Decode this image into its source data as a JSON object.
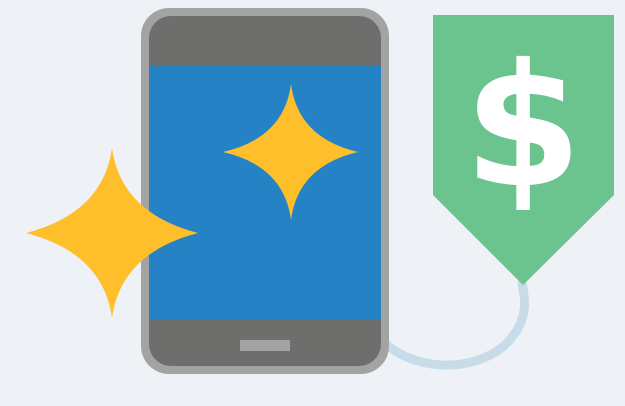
{
  "illustration": {
    "price_tag": {
      "symbol": "$",
      "color": "#6bc38d",
      "symbol_color": "#ffffff",
      "string_color": "#c7dce8"
    },
    "phone": {
      "frame_color": "#a3a3a3",
      "body_color": "#6e6e6c",
      "screen_color": "#2583c5",
      "home_button_color": "#a3a3a3"
    },
    "sparkles": {
      "color": "#ffbf2b",
      "count": 2
    },
    "background_color": "#eef2f6"
  }
}
